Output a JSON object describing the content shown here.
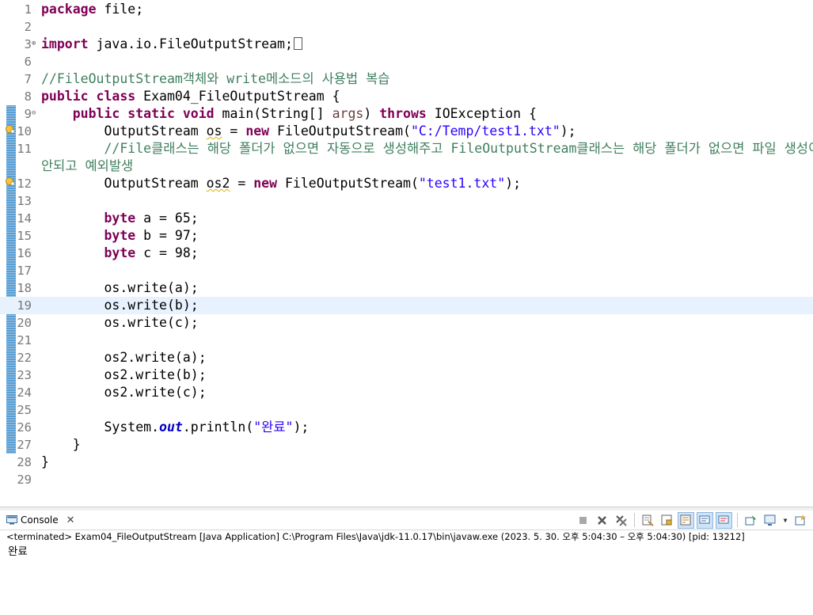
{
  "editor": {
    "line_numbers": [
      "1",
      "2",
      "3",
      "6",
      "7",
      "8",
      "9",
      "10",
      "11",
      "",
      "12",
      "13",
      "14",
      "15",
      "16",
      "17",
      "18",
      "19",
      "20",
      "21",
      "22",
      "23",
      "24",
      "25",
      "26",
      "27",
      "28",
      "29"
    ],
    "lines": {
      "l1_kw": "package",
      "l1_rest": " file;",
      "l3_kw": "import",
      "l3_rest": " java.io.FileOutputStream;",
      "l7_comment": "//FileOutputStream객체와 write메소드의 사용법 복습",
      "l8_kw1": "public",
      "l8_kw2": "class",
      "l8_rest": " Exam04_FileOutputStream {",
      "l9_kw1": "public",
      "l9_kw2": "static",
      "l9_kw3": "void",
      "l9_mid": " main(String[] ",
      "l9_arg": "args",
      "l9_mid2": ") ",
      "l9_kw4": "throws",
      "l9_rest": " IOException {",
      "l10_a": "OutputStream ",
      "l10_var": "os",
      "l10_b": " = ",
      "l10_kw": "new",
      "l10_c": " FileOutputStream(",
      "l10_str": "\"C:/Temp/test1.txt\"",
      "l10_d": ");",
      "l11_comment": "//File클래스는 해당 폴더가 없으면 자동으로 생성해주고 FileOutputStream클래스는 해당 폴더가 없으면 파일 생성이",
      "l11_cont": "안되고 예외발생",
      "l12_a": "OutputStream ",
      "l12_var": "os2",
      "l12_b": " = ",
      "l12_kw": "new",
      "l12_c": " FileOutputStream(",
      "l12_str": "\"test1.txt\"",
      "l12_d": ");",
      "l14_kw": "byte",
      "l14_rest": " a = 65;",
      "l15_kw": "byte",
      "l15_rest": " b = 97;",
      "l16_kw": "byte",
      "l16_rest": " c = 98;",
      "l18": "os.write(a);",
      "l19": "os.write(b);",
      "l20": "os.write(c);",
      "l22": "os2.write(a);",
      "l23": "os2.write(b);",
      "l24": "os2.write(c);",
      "l26_a": "System.",
      "l26_field": "out",
      "l26_b": ".println(",
      "l26_str": "\"완료\"",
      "l26_c": ");",
      "l27": "}",
      "l28": "}"
    }
  },
  "console": {
    "tab_label": "Console",
    "status": "<terminated> Exam04_FileOutputStream [Java Application] C:\\Program Files\\Java\\jdk-11.0.17\\bin\\javaw.exe  (2023. 5. 30. 오후 5:04:30 – 오후 5:04:30) [pid: 13212]",
    "output": "완료"
  },
  "colors": {
    "keyword": "#7f0055",
    "string": "#2a00ff",
    "comment": "#3f7f5f",
    "static_field": "#0000c0",
    "current_line": "#e8f2fe",
    "quickdiff": "#5a9fd4"
  },
  "icons": [
    "console-icon",
    "close-icon",
    "terminate-icon",
    "remove-launch-icon",
    "remove-all-icon",
    "clear-console-icon",
    "scroll-lock-icon",
    "word-wrap-icon",
    "show-on-stdout-icon",
    "show-on-stderr-icon",
    "pin-console-icon",
    "display-console-icon",
    "open-console-icon"
  ]
}
